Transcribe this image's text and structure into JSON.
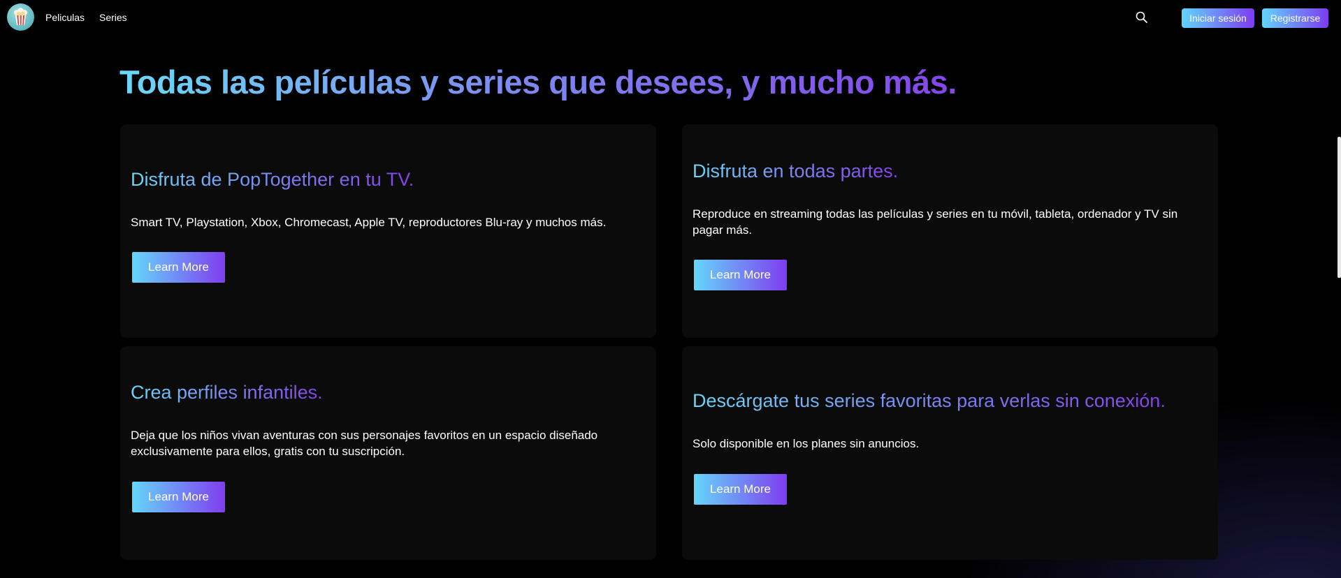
{
  "nav": {
    "logo_icon": "popcorn-icon",
    "links": [
      {
        "label": "Peliculas"
      },
      {
        "label": "Series"
      }
    ],
    "search_icon": "search-icon",
    "login_label": "Iniciar sesión",
    "register_label": "Registrarse"
  },
  "hero": {
    "headline": "Todas las películas y series que desees, y mucho más."
  },
  "cards": [
    {
      "title": "Disfruta de PopTogether en tu TV.",
      "text": "Smart TV, Playstation, Xbox, Chromecast, Apple TV, reproductores Blu-ray y muchos más.",
      "button": "Learn More"
    },
    {
      "title": "Disfruta en todas partes.",
      "text": "Reproduce en streaming todas las películas y series en tu móvil, tableta, ordenador y TV sin pagar más.",
      "button": "Learn More"
    },
    {
      "title": "Crea perfiles infantiles.",
      "text": "Deja que los niños vivan aventuras con sus personajes favoritos en un espacio diseñado exclusivamente para ellos, gratis con tu suscripción.",
      "button": "Learn More"
    },
    {
      "title": "Descárgate tus series favoritas para verlas sin conexión.",
      "text": "Solo disponible en los planes sin anuncios.",
      "button": "Learn More"
    }
  ],
  "colors": {
    "background": "#000000",
    "card_background": "#0b0b0c",
    "accent_start": "#62d4fb",
    "accent_end": "#7c3cf0"
  }
}
